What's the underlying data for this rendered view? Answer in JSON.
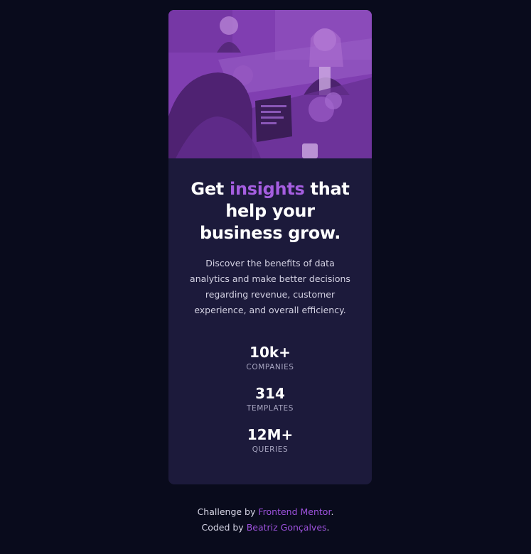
{
  "card": {
    "image_alt": "Team collaborating at office desks with laptops",
    "headline": {
      "before": "Get ",
      "accent": "insights",
      "after": " that help your business grow."
    },
    "description": "Discover the benefits of data analytics and make better decisions regarding revenue, customer experience, and overall efficiency.",
    "stats": [
      {
        "value": "10k+",
        "label": "COMPANIES"
      },
      {
        "value": "314",
        "label": "TEMPLATES"
      },
      {
        "value": "12M+",
        "label": "QUERIES"
      }
    ]
  },
  "footer": {
    "challenge_prefix": "Challenge by ",
    "challenge_link": "Frontend Mentor",
    "challenge_suffix": ".",
    "coded_prefix": "Coded by ",
    "coded_link": "Beatriz Gonçalves",
    "coded_suffix": "."
  },
  "colors": {
    "page_bg": "#090b1c",
    "card_bg": "#1c1a3b",
    "accent": "#a55ee0",
    "hero_overlay": "#8a44b8"
  }
}
